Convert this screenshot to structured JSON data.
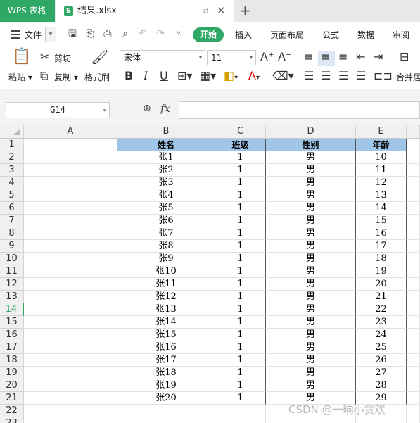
{
  "titlebar": {
    "app_tab": "WPS 表格",
    "file_icon": "S",
    "file_name": "结果.xlsx",
    "restore_glyph": "⧉",
    "close_glyph": "✕",
    "new_tab_glyph": "+"
  },
  "menu": {
    "file": "文件",
    "start": "开始",
    "items": [
      "插入",
      "页面布局",
      "公式",
      "数据",
      "审阅"
    ]
  },
  "ribbon": {
    "paste": "粘贴",
    "cut": "剪切",
    "copy": "复制",
    "format_painter": "格式刷",
    "font": "宋体",
    "font_size": "11",
    "merge": "合并居"
  },
  "formula_bar": {
    "name_box": "G14",
    "fx": "fx",
    "formula": ""
  },
  "sheet": {
    "columns": [
      "A",
      "B",
      "C",
      "D",
      "E"
    ],
    "header_row": [
      "姓名",
      "班级",
      "性别",
      "年龄"
    ],
    "rows": [
      [
        "张1",
        "1",
        "男",
        "10"
      ],
      [
        "张2",
        "1",
        "男",
        "11"
      ],
      [
        "张3",
        "1",
        "男",
        "12"
      ],
      [
        "张4",
        "1",
        "男",
        "13"
      ],
      [
        "张5",
        "1",
        "男",
        "14"
      ],
      [
        "张6",
        "1",
        "男",
        "15"
      ],
      [
        "张7",
        "1",
        "男",
        "16"
      ],
      [
        "张8",
        "1",
        "男",
        "17"
      ],
      [
        "张9",
        "1",
        "男",
        "18"
      ],
      [
        "张10",
        "1",
        "男",
        "19"
      ],
      [
        "张11",
        "1",
        "男",
        "20"
      ],
      [
        "张12",
        "1",
        "男",
        "21"
      ],
      [
        "张13",
        "1",
        "男",
        "22"
      ],
      [
        "张14",
        "1",
        "男",
        "23"
      ],
      [
        "张15",
        "1",
        "男",
        "24"
      ],
      [
        "张16",
        "1",
        "男",
        "25"
      ],
      [
        "张17",
        "1",
        "男",
        "26"
      ],
      [
        "张18",
        "1",
        "男",
        "27"
      ],
      [
        "张19",
        "1",
        "男",
        "28"
      ],
      [
        "张20",
        "1",
        "男",
        "29"
      ]
    ],
    "row_numbers": [
      "1",
      "2",
      "3",
      "4",
      "5",
      "6",
      "7",
      "8",
      "9",
      "10",
      "11",
      "12",
      "13",
      "14",
      "15",
      "16",
      "17",
      "18",
      "19",
      "20",
      "21",
      "22",
      "23"
    ],
    "active_row": "14"
  },
  "watermark": "CSDN @一晌小贪欢",
  "colors": {
    "accent": "#2fa765",
    "header_fill": "#9fc5e8"
  }
}
